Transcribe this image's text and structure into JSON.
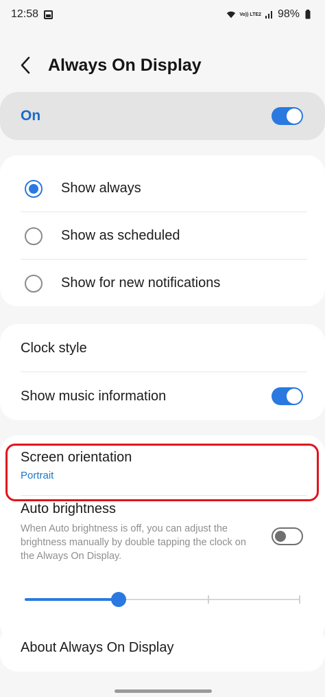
{
  "status_bar": {
    "time": "12:58",
    "network_label": "Vo)) LTE2",
    "battery": "98%"
  },
  "header": {
    "title": "Always On Display"
  },
  "master_switch": {
    "label": "On",
    "checked": true
  },
  "display_mode": {
    "options": [
      {
        "label": "Show always",
        "selected": true
      },
      {
        "label": "Show as scheduled",
        "selected": false
      },
      {
        "label": "Show for new notifications",
        "selected": false
      }
    ]
  },
  "settings": {
    "clock_style_label": "Clock style",
    "music_info_label": "Show music information",
    "music_info_checked": true,
    "orientation_title": "Screen orientation",
    "orientation_value": "Portrait",
    "auto_brightness_title": "Auto brightness",
    "auto_brightness_desc": "When Auto brightness is off, you can adjust the brightness manually by double tapping the clock on the Always On Display.",
    "auto_brightness_checked": false,
    "brightness_level": 0.34,
    "about_label": "About Always On Display"
  },
  "colors": {
    "accent": "#2a79e0",
    "highlight": "#e0141c",
    "value_text": "#1a78c8"
  }
}
